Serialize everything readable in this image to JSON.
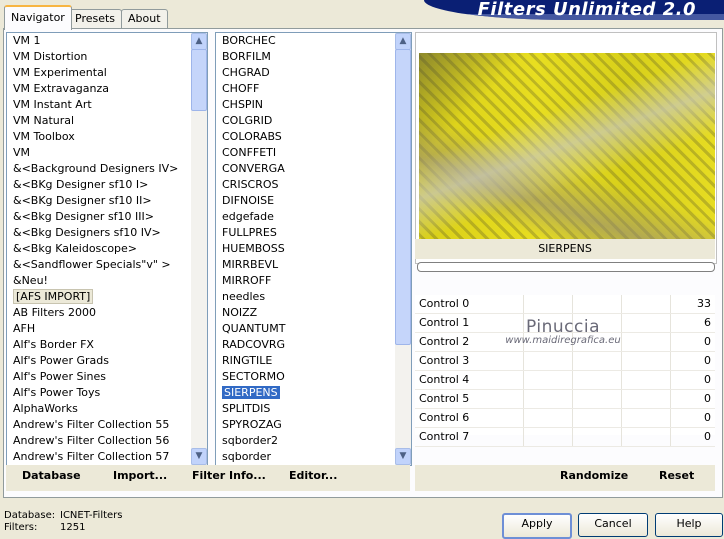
{
  "app": {
    "title": "Filters Unlimited 2.0"
  },
  "tabs": [
    {
      "label": "Navigator",
      "active": true
    },
    {
      "label": "Presets",
      "active": false
    },
    {
      "label": "About",
      "active": false
    }
  ],
  "categories": [
    "VM 1",
    "VM Distortion",
    "VM Experimental",
    "VM Extravaganza",
    "VM Instant Art",
    "VM Natural",
    "VM Toolbox",
    "VM",
    "&<Background Designers IV>",
    "&<BKg Designer sf10 I>",
    "&<BKg Designer sf10 II>",
    "&<Bkg Designer sf10 III>",
    "&<Bkg Designers sf10 IV>",
    "&<Bkg Kaleidoscope>",
    "&<Sandflower Specials\"v\" >",
    "&Neu!",
    "[AFS IMPORT]",
    "AB Filters 2000",
    "AFH",
    "Alf's Border FX",
    "Alf's Power Grads",
    "Alf's Power Sines",
    "Alf's Power Toys",
    "AlphaWorks",
    "Andrew's Filter Collection 55",
    "Andrew's Filter Collection 56",
    "Andrew's Filter Collection 57"
  ],
  "selected_category": "[AFS IMPORT]",
  "filters": [
    "BORCHEC",
    "BORFILM",
    "CHGRAD",
    "CHOFF",
    "CHSPIN",
    "COLGRID",
    "COLORABS",
    "CONFFETI",
    "CONVERGA",
    "CRISCROS",
    "DIFNOISE",
    "edgefade",
    "FULLPRES",
    "HUEMBOSS",
    "MIRRBEVL",
    "MIRROFF",
    "needles",
    "NOIZZ",
    "QUANTUMT",
    "RADCOVRG",
    "RINGTILE",
    "SECTORMO",
    "SIERPENS",
    "SPLITDIS",
    "SPYROZAG",
    "sqborder2",
    "sqborder"
  ],
  "selected_filter": "SIERPENS",
  "preview": {
    "filter_name": "SIERPENS",
    "colors": {
      "yellow": "#e2d81e",
      "dark": "#3a3a20"
    }
  },
  "controls": [
    {
      "label": "Control 0",
      "value": "33"
    },
    {
      "label": "Control 1",
      "value": "6"
    },
    {
      "label": "Control 2",
      "value": "0"
    },
    {
      "label": "Control 3",
      "value": "0"
    },
    {
      "label": "Control 4",
      "value": "0"
    },
    {
      "label": "Control 5",
      "value": "0"
    },
    {
      "label": "Control 6",
      "value": "0"
    },
    {
      "label": "Control 7",
      "value": "0"
    }
  ],
  "watermark": {
    "name": "Pinuccia",
    "site": "www.maidiregrafica.eu"
  },
  "left_buttons": [
    "Database",
    "Import...",
    "Filter Info...",
    "Editor..."
  ],
  "right_buttons": [
    "Randomize",
    "Reset"
  ],
  "footer": {
    "database_label": "Database:",
    "database_value": "ICNET-Filters",
    "filters_label": "Filters:",
    "filters_value": "1251"
  },
  "dialog_buttons": {
    "apply": "Apply",
    "cancel": "Cancel",
    "help": "Help"
  }
}
